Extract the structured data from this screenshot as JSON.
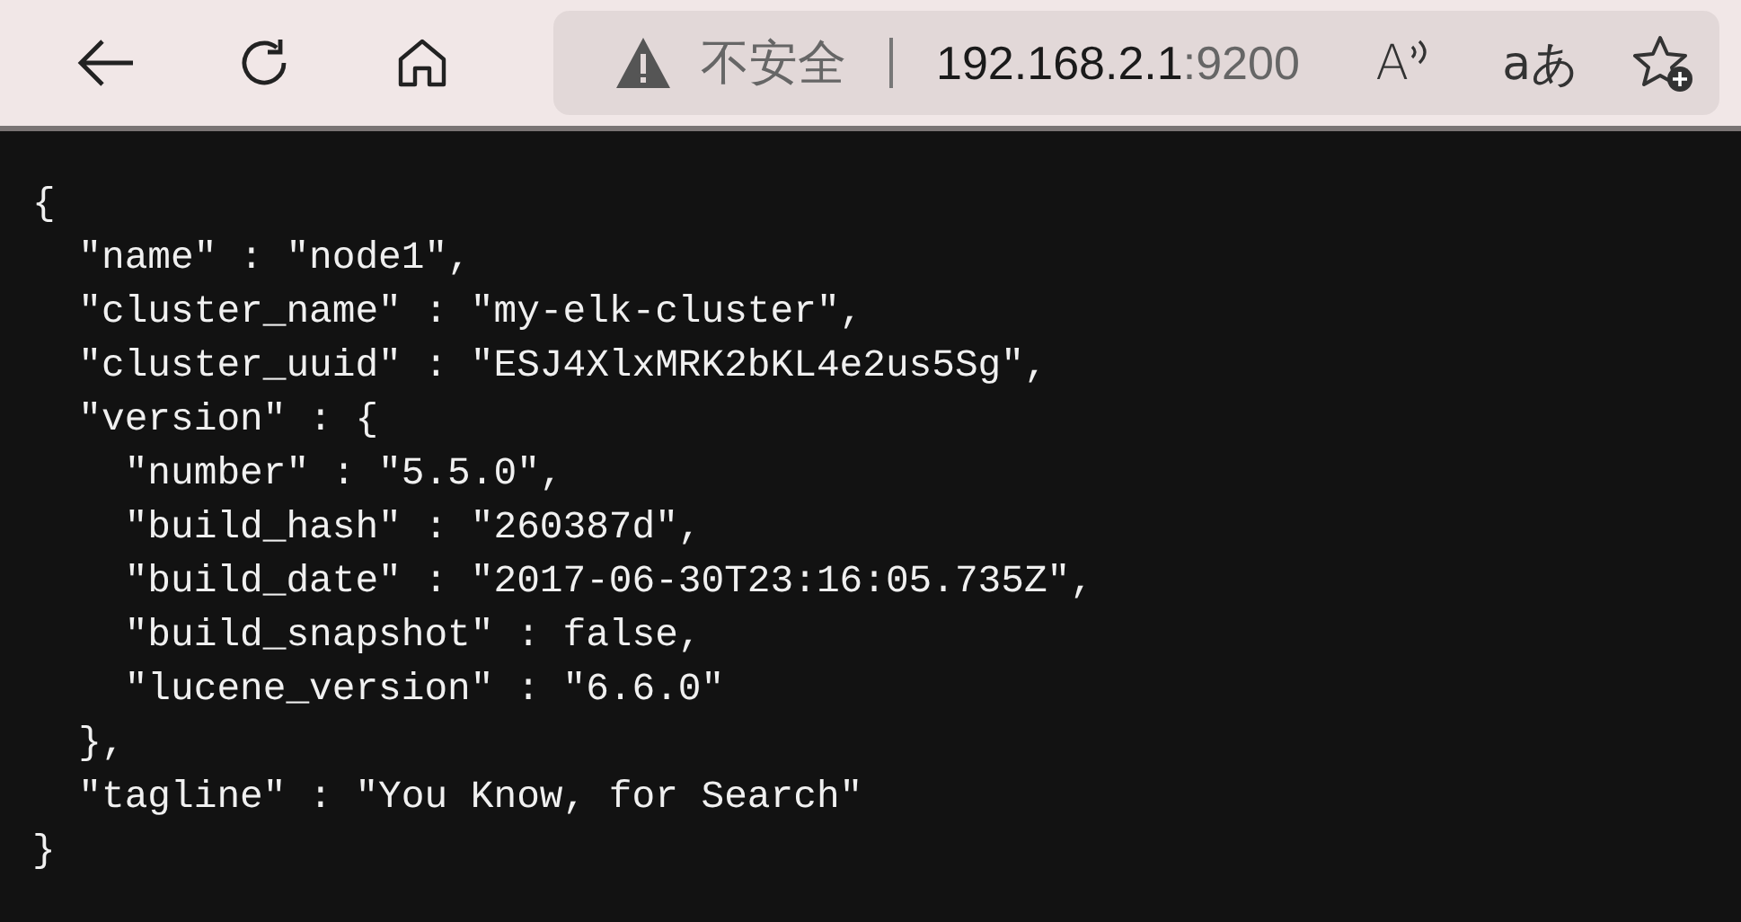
{
  "toolbar": {
    "address_bar": {
      "security_label": "不安全",
      "host": "192.168.2.1",
      "port": ":9200",
      "read_aloud_glyph": "A",
      "translate_glyph": "aあ"
    }
  },
  "page": {
    "lines": [
      "{",
      "  \"name\" : \"node1\",",
      "  \"cluster_name\" : \"my-elk-cluster\",",
      "  \"cluster_uuid\" : \"ESJ4XlxMRK2bKL4e2us5Sg\",",
      "  \"version\" : {",
      "    \"number\" : \"5.5.0\",",
      "    \"build_hash\" : \"260387d\",",
      "    \"build_date\" : \"2017-06-30T23:16:05.735Z\",",
      "    \"build_snapshot\" : false,",
      "    \"lucene_version\" : \"6.6.0\"",
      "  },",
      "  \"tagline\" : \"You Know, for Search\"",
      "}"
    ]
  }
}
